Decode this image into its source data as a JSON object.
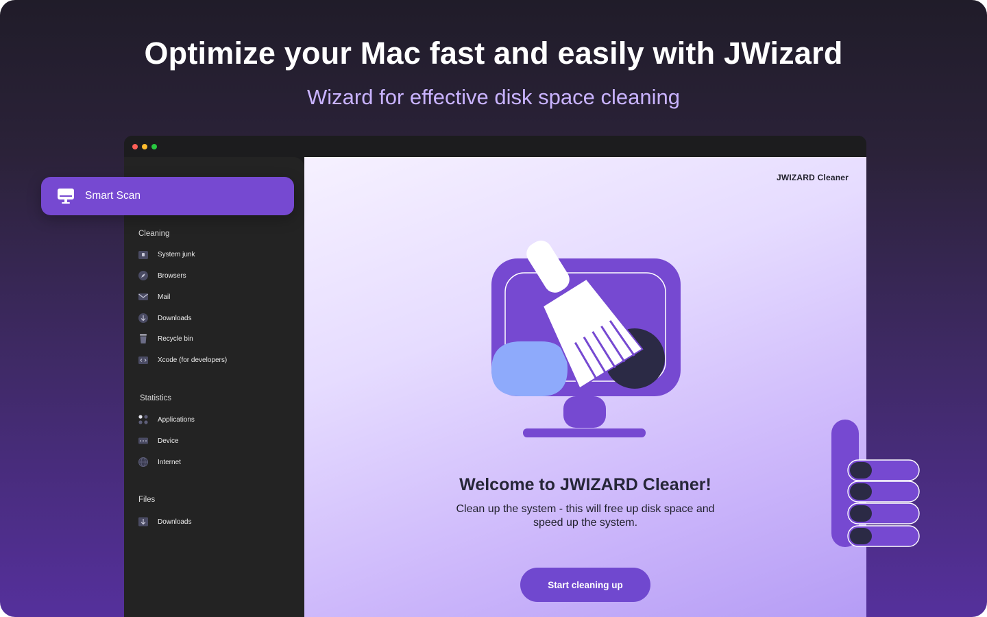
{
  "hero": {
    "headline": "Optimize your Mac fast and easily with JWizard",
    "subheadline": "Wizard for effective disk space cleaning"
  },
  "app": {
    "brand": "JWIZARD Cleaner"
  },
  "sidebar": {
    "smart_scan": {
      "label": "Smart Scan",
      "icon": "monitor-icon"
    },
    "sections": [
      {
        "title": "Cleaning",
        "items": [
          {
            "label": "System junk",
            "icon": "lock-icon"
          },
          {
            "label": "Browsers",
            "icon": "compass-icon"
          },
          {
            "label": "Mail",
            "icon": "envelope-icon"
          },
          {
            "label": "Downloads",
            "icon": "download-icon"
          },
          {
            "label": "Recycle bin",
            "icon": "trash-icon"
          },
          {
            "label": "Xcode (for developers)",
            "icon": "code-icon"
          }
        ]
      },
      {
        "title": "Statistics",
        "items": [
          {
            "label": "Applications",
            "icon": "apps-icon"
          },
          {
            "label": "Device",
            "icon": "device-icon"
          },
          {
            "label": "Internet",
            "icon": "globe-icon"
          }
        ]
      },
      {
        "title": "Files",
        "items": [
          {
            "label": "Downloads",
            "icon": "download-icon"
          }
        ]
      }
    ]
  },
  "welcome": {
    "title": "Welcome to JWIZARD Cleaner!",
    "text": "Clean up the system - this will free up disk space and speed up the system.",
    "button": "Start cleaning up"
  },
  "colors": {
    "accent": "#7649d1",
    "dark": "#2b2a45",
    "light_blue": "#8eaafb"
  }
}
